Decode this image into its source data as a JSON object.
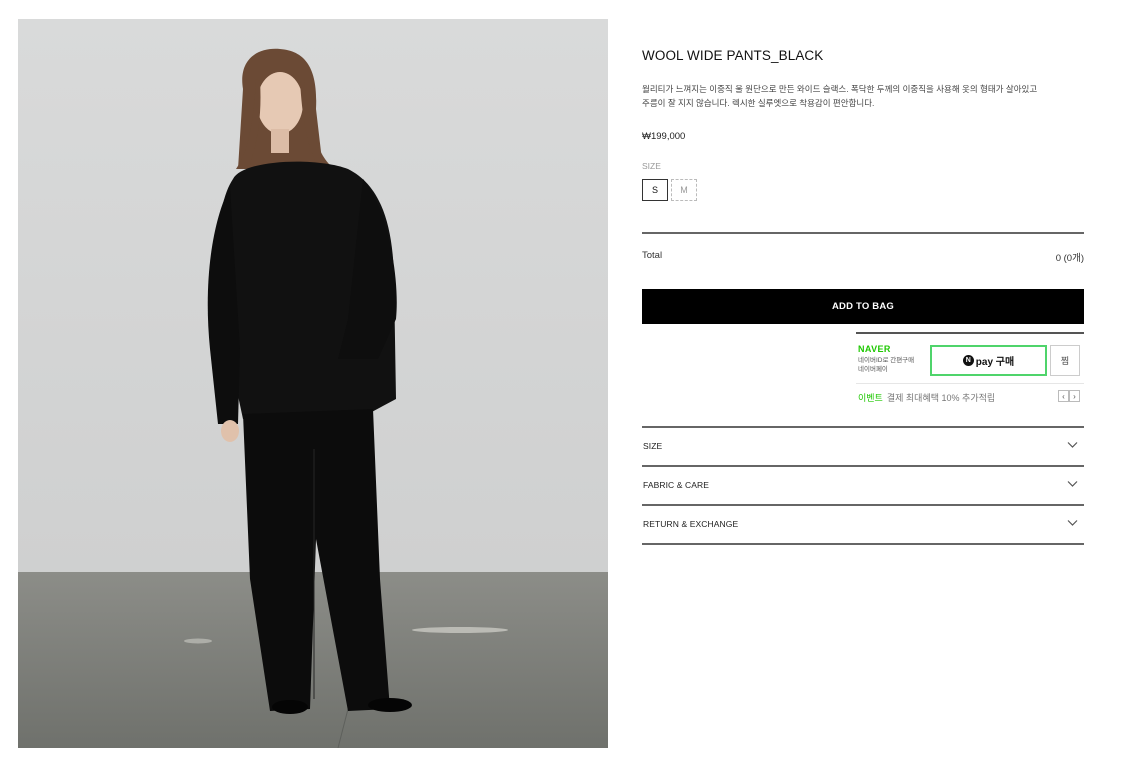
{
  "product": {
    "title": "WOOL WIDE PANTS_BLACK",
    "description_line1": "월리티가 느껴지는 이중직 울 원단으로 만든 와이드 슬랙스. 폭닥한 두께의 이중직을 사용해 옷의 형태가 살아있고",
    "description_line2": "주름이 잘 지지 않습니다. 렉시한 실루엣으로 착용감이 편안합니다.",
    "price": "₩199,000"
  },
  "size_selector": {
    "label": "SIZE",
    "options": [
      "S",
      "M"
    ],
    "selected": "S"
  },
  "total": {
    "label": "Total",
    "value": "0 (0개)"
  },
  "add_to_bag_label": "ADD TO BAG",
  "naver_pay": {
    "logo": "NAVER",
    "sub_line1": "네이버ID로 간편구매",
    "sub_line2": "네이버페이",
    "button_mark": "N",
    "button_label": "pay 구매",
    "wish_label": "찜",
    "event_highlight": "이벤트",
    "event_text": "결제 최대혜택 10% 추가적립",
    "prev": "‹",
    "next": "›"
  },
  "accordion": [
    {
      "label": "SIZE"
    },
    {
      "label": "FABRIC & CARE"
    },
    {
      "label": "RETURN & EXCHANGE"
    }
  ],
  "colors": {
    "button_bg": "#000000",
    "naver_green": "#1ec800",
    "npay_border": "#4fd46b",
    "rule": "#555555"
  }
}
